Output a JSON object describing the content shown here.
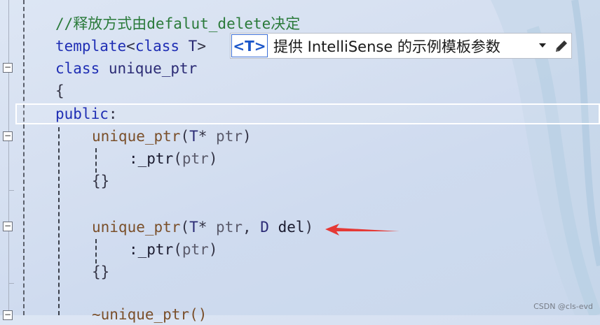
{
  "editor": {
    "lines": [
      {
        "id": "l1",
        "tokens": [
          {
            "t": "//释放方式由defalut_delete决定",
            "c": "cm"
          }
        ]
      },
      {
        "id": "l2",
        "tokens": [
          {
            "t": "template",
            "c": "kw"
          },
          {
            "t": "<",
            "c": "pu"
          },
          {
            "t": "class",
            "c": "kw"
          },
          {
            "t": " T",
            "c": "ty"
          },
          {
            "t": ">",
            "c": "pu"
          }
        ]
      },
      {
        "id": "l3",
        "tokens": [
          {
            "t": "class",
            "c": "kw"
          },
          {
            "t": " unique_ptr",
            "c": "ty"
          }
        ]
      },
      {
        "id": "l4",
        "tokens": [
          {
            "t": "{",
            "c": "pu"
          }
        ]
      },
      {
        "id": "l5",
        "tokens": [
          {
            "t": "public",
            "c": "kw"
          },
          {
            "t": ":",
            "c": "pu"
          }
        ]
      },
      {
        "id": "l6",
        "tokens": [
          {
            "t": "unique_ptr",
            "c": "fn"
          },
          {
            "t": "(",
            "c": "pu"
          },
          {
            "t": "T",
            "c": "ty"
          },
          {
            "t": "* ",
            "c": "pu"
          },
          {
            "t": "ptr",
            "c": "pm"
          },
          {
            "t": ")",
            "c": "pu"
          }
        ]
      },
      {
        "id": "l7",
        "tokens": [
          {
            "t": ":_ptr",
            "c": "id"
          },
          {
            "t": "(",
            "c": "pu"
          },
          {
            "t": "ptr",
            "c": "pm"
          },
          {
            "t": ")",
            "c": "pu"
          }
        ]
      },
      {
        "id": "l8",
        "tokens": [
          {
            "t": "{}",
            "c": "pu"
          }
        ]
      },
      {
        "id": "l9",
        "tokens": [
          {
            "t": "unique_ptr",
            "c": "fn"
          },
          {
            "t": "(",
            "c": "pu"
          },
          {
            "t": "T",
            "c": "ty"
          },
          {
            "t": "* ",
            "c": "pu"
          },
          {
            "t": "ptr",
            "c": "pm"
          },
          {
            "t": ", ",
            "c": "pu"
          },
          {
            "t": "D",
            "c": "ty"
          },
          {
            "t": " del",
            "c": "id"
          },
          {
            "t": ")",
            "c": "pu"
          }
        ]
      },
      {
        "id": "l10",
        "tokens": [
          {
            "t": ":_ptr",
            "c": "id"
          },
          {
            "t": "(",
            "c": "pu"
          },
          {
            "t": "ptr",
            "c": "pm"
          },
          {
            "t": ")",
            "c": "pu"
          }
        ]
      },
      {
        "id": "l11",
        "tokens": [
          {
            "t": "{}",
            "c": "pu"
          }
        ]
      },
      {
        "id": "l12",
        "tokens": [
          {
            "t": "~unique_ptr()",
            "c": "fn"
          }
        ]
      }
    ]
  },
  "tooltip": {
    "tag": "<T>",
    "text": "提供 IntelliSense 的示例模板参数",
    "dropdown_icon": "caret-down-icon",
    "edit_icon": "pencil-icon"
  },
  "annotation": {
    "color": "#e53935",
    "icon": "red-arrow-icon"
  },
  "watermark": "CSDN @cls-evd",
  "fold_markers": [
    "−",
    "−",
    "−",
    "−"
  ]
}
